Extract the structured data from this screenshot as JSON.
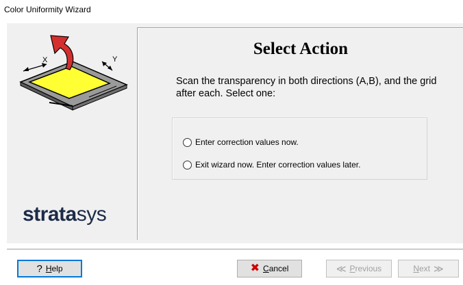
{
  "window": {
    "title": "Color Uniformity Wizard"
  },
  "illustration": {
    "axis_x_label": "X",
    "axis_y_label": "Y"
  },
  "logo": {
    "text_bold": "strata",
    "text_regular": "sys"
  },
  "main": {
    "heading": "Select Action",
    "instructions": "Scan the transparency in both directions (A,B), and the grid after each. Select one:",
    "options": [
      {
        "label": "Enter correction values now.",
        "selected": false
      },
      {
        "label": "Exit wizard now. Enter correction values later.",
        "selected": false
      }
    ]
  },
  "buttons": {
    "help": {
      "icon": "question-icon",
      "pre": "",
      "accel": "H",
      "post": "elp"
    },
    "cancel": {
      "icon": "x-icon",
      "pre": "",
      "accel": "C",
      "post": "ancel"
    },
    "previous": {
      "icon": "chevron-left-icon",
      "pre": "",
      "accel": "P",
      "post": "revious",
      "disabled": true
    },
    "next": {
      "icon": "chevron-right-icon",
      "pre": "",
      "accel": "N",
      "post": "ext",
      "disabled": true
    }
  },
  "colors": {
    "dialog_bg": "#f0f0f0",
    "logo": "#1c2b47",
    "focus_border": "#0078d7",
    "cancel_icon": "#cc0000",
    "arrow": "#d32f2f",
    "yellow_sheet": "#ffff33"
  }
}
